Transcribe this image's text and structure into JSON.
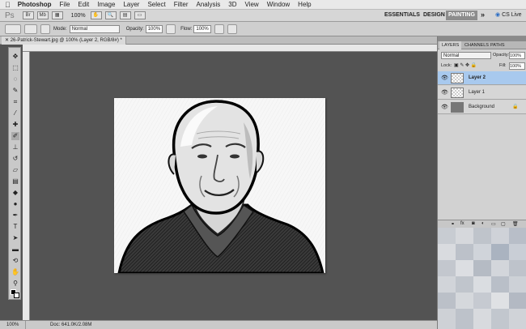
{
  "menubar": {
    "app_name": "Photoshop",
    "items": [
      "File",
      "Edit",
      "Image",
      "Layer",
      "Select",
      "Filter",
      "Analysis",
      "3D",
      "View",
      "Window",
      "Help"
    ]
  },
  "appbar": {
    "logo": "Ps",
    "zoom": "100%",
    "workspaces": [
      "ESSENTIALS",
      "DESIGN",
      "PAINTING"
    ],
    "active_workspace": "PAINTING",
    "more": "»",
    "cslive": "CS Live"
  },
  "options": {
    "mode_label": "Mode:",
    "mode_value": "Normal",
    "opacity_label": "Opacity:",
    "opacity_value": "100%",
    "flow_label": "Flow:",
    "flow_value": "100%"
  },
  "document": {
    "tab_title": "26-Patrick-Stewart.jpg @ 100% (Layer 2, RGB/8#) *"
  },
  "status": {
    "zoom": "100%",
    "doc_info": "Doc: 641.0K/2.08M"
  },
  "layers_panel": {
    "tabs": [
      "LAYERS",
      "CHANNELS",
      "PATHS"
    ],
    "blend_mode": "Normal",
    "opacity_label": "Opacity:",
    "opacity_value": "100%",
    "lock_label": "Lock:",
    "fill_label": "Fill:",
    "fill_value": "100%",
    "layers": [
      {
        "name": "Layer 2",
        "selected": true
      },
      {
        "name": "Layer 1",
        "selected": false
      },
      {
        "name": "Background",
        "selected": false
      }
    ]
  },
  "colors": {
    "selection": "#a8c9ee",
    "canvas_bg": "#535353",
    "active_workspace_bg": "#8c8c8c"
  }
}
